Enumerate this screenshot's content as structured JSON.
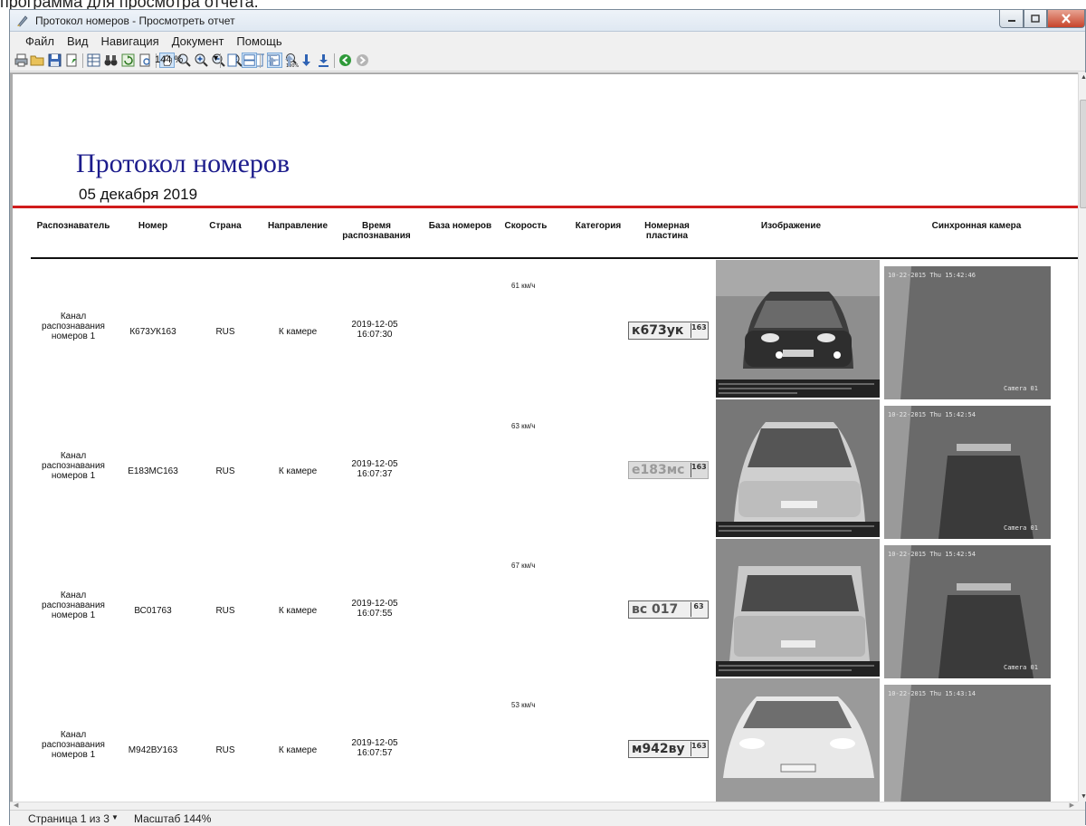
{
  "caption_top": "программа для просмотра отчета.",
  "window": {
    "title": "Протокол номеров - Просмотреть отчет",
    "buttons": {
      "minimize": "minimize-button",
      "maximize": "maximize-button",
      "close": "close-button"
    }
  },
  "menu": [
    "Файл",
    "Вид",
    "Навигация",
    "Документ",
    "Помощь"
  ],
  "toolbar": {
    "zoom_value": "144 %",
    "icons": [
      "printer-icon",
      "open-folder-icon",
      "save-icon",
      "export-icon",
      "table-icon",
      "binoculars-icon",
      "refresh-icon",
      "page-preview-icon",
      "hand-icon",
      "zoom-icon",
      "zoom-in-icon",
      "zoom-out-icon",
      "zoom-region-icon",
      "fit-page-icon",
      "fit-width-icon",
      "actual-size-icon",
      "single-page-icon",
      "two-pages-icon",
      "first-page-icon",
      "previous-page-icon",
      "next-page-icon",
      "last-page-icon",
      "go-back-icon",
      "go-forward-icon"
    ]
  },
  "report": {
    "title": "Протокол номеров",
    "date": "05 декабря 2019",
    "columns": [
      "Распознаватель",
      "Номер",
      "Страна",
      "Направление",
      "Время распознавания",
      "База номеров",
      "Скорость",
      "Категория",
      "Номерная пластина",
      "Изображение",
      "Синхронная камера"
    ],
    "rows": [
      {
        "recognizer": "Канал распознавания номеров 1",
        "number": "К673УК163",
        "country": "RUS",
        "direction": "К камере",
        "time": "2019-12-05 16:07:30",
        "speed": "61 км/ч",
        "plate_text": "к673ук",
        "plate_region": "163",
        "sync_overlay": "10-22-2015 Thu 15:42:46",
        "sync_cam": "Camera 01"
      },
      {
        "recognizer": "Канал распознавания номеров 1",
        "number": "Е183МС163",
        "country": "RUS",
        "direction": "К камере",
        "time": "2019-12-05 16:07:37",
        "speed": "63 км/ч",
        "plate_text": "е183мс",
        "plate_region": "163",
        "sync_overlay": "10-22-2015 Thu 15:42:54",
        "sync_cam": "Camera 01"
      },
      {
        "recognizer": "Канал распознавания номеров 1",
        "number": "ВС01763",
        "country": "RUS",
        "direction": "К камере",
        "time": "2019-12-05 16:07:55",
        "speed": "67 км/ч",
        "plate_text": "вс 017",
        "plate_region": "63",
        "sync_overlay": "10-22-2015 Thu 15:42:54",
        "sync_cam": "Camera 01"
      },
      {
        "recognizer": "Канал распознавания номеров 1",
        "number": "М942ВУ163",
        "country": "RUS",
        "direction": "К камере",
        "time": "2019-12-05 16:07:57",
        "speed": "53 км/ч",
        "plate_text": "м942ву",
        "plate_region": "163",
        "sync_overlay": "10-22-2015 Thu 15:43:14",
        "sync_cam": ""
      }
    ]
  },
  "status": {
    "page_info": "Страница 1 из 3",
    "scale": "Масштаб 144%"
  }
}
